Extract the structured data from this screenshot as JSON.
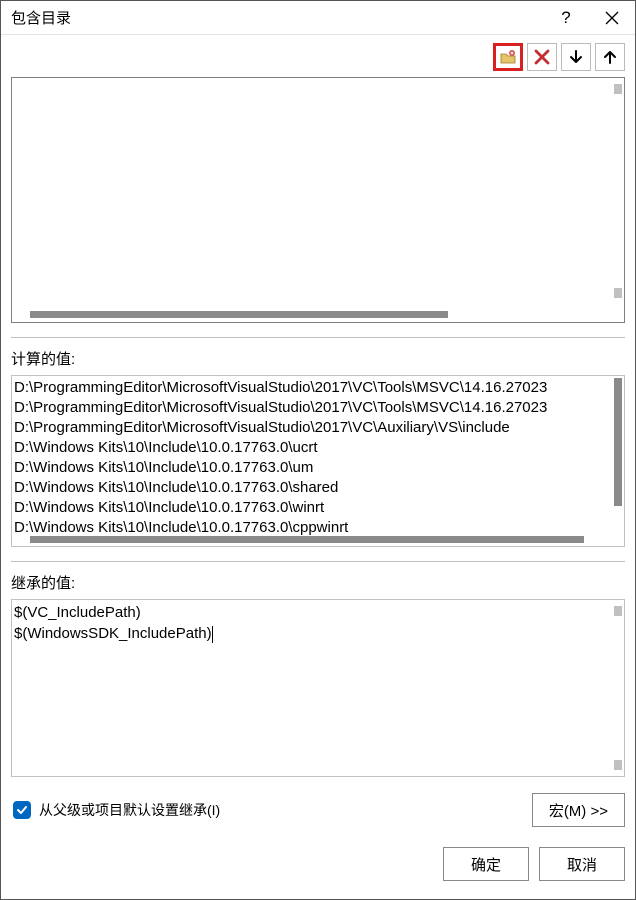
{
  "title": "包含目录",
  "toolbar": {
    "new_folder": "new-folder",
    "delete": "delete",
    "move_down": "move-down",
    "move_up": "move-up"
  },
  "computed": {
    "label": "计算的值:",
    "lines": [
      "D:\\ProgrammingEditor\\MicrosoftVisualStudio\\2017\\VC\\Tools\\MSVC\\14.16.27023",
      "D:\\ProgrammingEditor\\MicrosoftVisualStudio\\2017\\VC\\Tools\\MSVC\\14.16.27023",
      "D:\\ProgrammingEditor\\MicrosoftVisualStudio\\2017\\VC\\Auxiliary\\VS\\include",
      "D:\\Windows Kits\\10\\Include\\10.0.17763.0\\ucrt",
      "D:\\Windows Kits\\10\\Include\\10.0.17763.0\\um",
      "D:\\Windows Kits\\10\\Include\\10.0.17763.0\\shared",
      "D:\\Windows Kits\\10\\Include\\10.0.17763.0\\winrt",
      "D:\\Windows Kits\\10\\Include\\10.0.17763.0\\cppwinrt"
    ]
  },
  "inherited": {
    "label": "继承的值:",
    "lines": [
      "$(VC_IncludePath)",
      "$(WindowsSDK_IncludePath)"
    ]
  },
  "inherit_checkbox": {
    "checked": true,
    "label": "从父级或项目默认设置继承(I)"
  },
  "buttons": {
    "macros": "宏(M) >>",
    "ok": "确定",
    "cancel": "取消"
  }
}
